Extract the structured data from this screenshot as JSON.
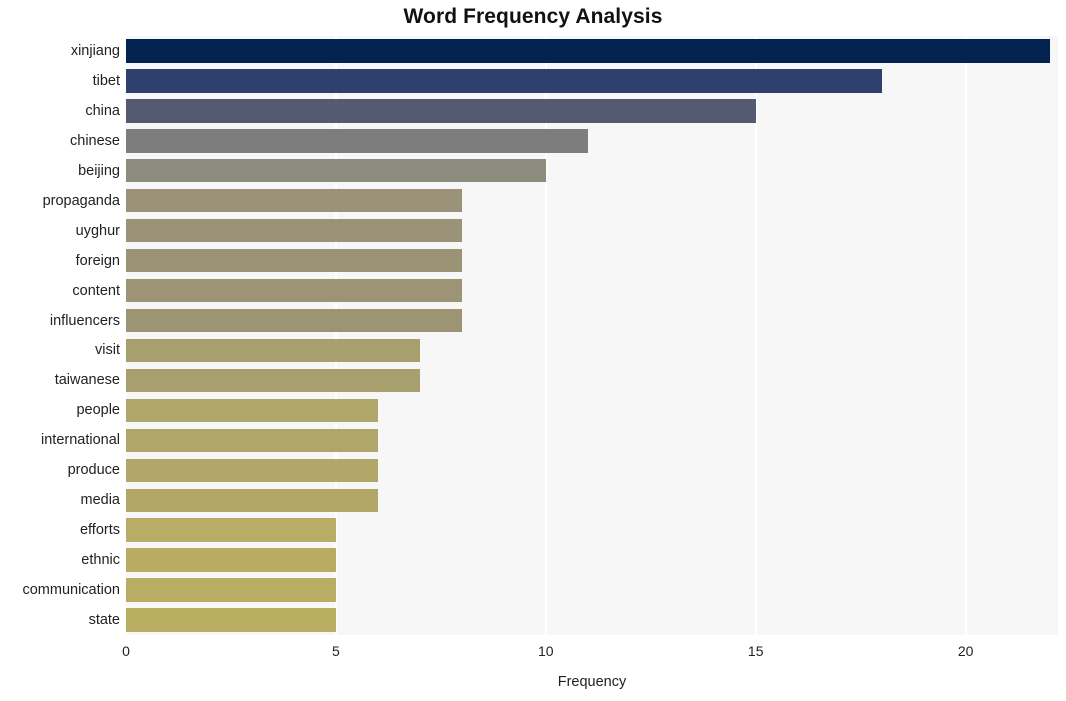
{
  "chart_data": {
    "type": "bar",
    "orientation": "horizontal",
    "title": "Word Frequency Analysis",
    "xlabel": "Frequency",
    "ylabel": "",
    "xlim": [
      0,
      22.2
    ],
    "ylim": null,
    "grid": "vertical-white",
    "legend": "none",
    "xticks": [
      "0",
      "5",
      "10",
      "15",
      "20"
    ],
    "xtick_values": [
      0,
      5,
      10,
      15,
      20
    ],
    "categories": [
      "xinjiang",
      "tibet",
      "china",
      "chinese",
      "beijing",
      "propaganda",
      "uyghur",
      "foreign",
      "content",
      "influencers",
      "visit",
      "taiwanese",
      "people",
      "international",
      "produce",
      "media",
      "efforts",
      "ethnic",
      "communication",
      "state"
    ],
    "values": [
      22,
      18,
      15,
      11,
      10,
      8,
      8,
      8,
      8,
      8,
      7,
      7,
      6,
      6,
      6,
      6,
      5,
      5,
      5,
      5
    ],
    "bar_colors": [
      "#032250",
      "#2f406c",
      "#555a70",
      "#7d7d7d",
      "#8b8b7e",
      "#9a9379",
      "#9a9377",
      "#9b9376",
      "#9d9475",
      "#9d9473",
      "#a89f6f",
      "#a89f6f",
      "#b1a66a",
      "#b1a669",
      "#b2a768",
      "#b2a767",
      "#b8ac66",
      "#b8ac65",
      "#b9ad64",
      "#baae63"
    ],
    "plot_background": "#f7f7f7",
    "figure_background": "#ffffff",
    "gridline_color": "#ffffff"
  }
}
